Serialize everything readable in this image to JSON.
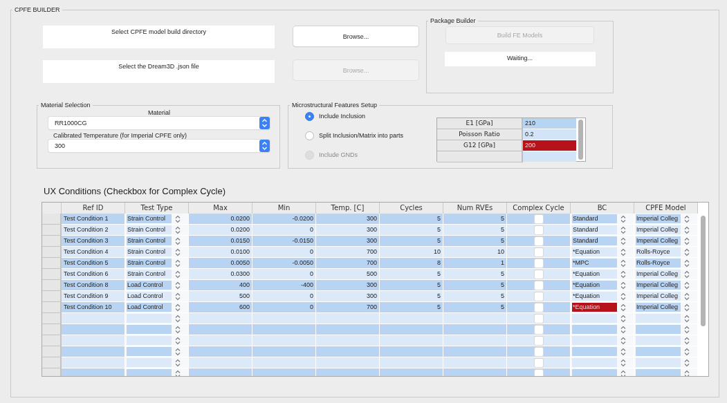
{
  "builder": {
    "title": "CPFE BUILDER",
    "directory": {
      "label": "Select CPFE model build directory",
      "browse": {
        "label": "Browse...",
        "disabled": false
      }
    },
    "json_file": {
      "label": "Select the Dream3D .json file",
      "browse": {
        "label": "Browse...",
        "disabled": true
      }
    },
    "package_builder": {
      "title": "Package Builder",
      "build_button": {
        "label": "Build FE Models",
        "disabled": true
      },
      "status": "Waiting..."
    },
    "material_selection": {
      "title": "Material Selection",
      "material_label": "Material",
      "material": "RR1000CG",
      "temperature_label": "Calibrated Temperature (for Imperial CPFE only)",
      "temperature": "300"
    },
    "microstructure": {
      "title": "Microstructural Features Setup",
      "options": [
        {
          "label": "Include Inclusion",
          "selected": true,
          "disabled": false
        },
        {
          "label": "Split Inclusion/Matrix into parts",
          "selected": false,
          "disabled": false
        },
        {
          "label": "Include GNDs",
          "selected": false,
          "disabled": true
        }
      ],
      "properties": [
        {
          "name": "E1 [GPa]",
          "value": "210",
          "invalid": false
        },
        {
          "name": "Poisson Ratio",
          "value": "0.2",
          "invalid": false
        },
        {
          "name": "G12 [GPa]",
          "value": "200",
          "invalid": true
        },
        {
          "invalid": false
        }
      ]
    },
    "ux_conditions": {
      "title": "UX Conditions (Checkbox for Complex Cycle)",
      "columns": [
        "Ref ID",
        "Test Type",
        "Max",
        "Min",
        "Temp. [C]",
        "Cycles",
        "Num RVEs",
        "Complex Cycle",
        "BC",
        "CPFE Model"
      ],
      "rows": [
        {
          "ref_id": "Test Condition 1",
          "test_type": "Strain Control",
          "max": "0.0200",
          "min": "-0.0200",
          "temp": "300",
          "cycles": "5",
          "num_rves": "5",
          "complex_cycle": false,
          "bc": "Standard",
          "bc_invalid": false,
          "cpfe_model": "Imperial Colleg"
        },
        {
          "ref_id": "Test Condition 2",
          "test_type": "Strain Control",
          "max": "0.0200",
          "min": "0",
          "temp": "300",
          "cycles": "5",
          "num_rves": "5",
          "complex_cycle": false,
          "bc": "Standard",
          "bc_invalid": false,
          "cpfe_model": "Imperial Colleg"
        },
        {
          "ref_id": "Test Condition 3",
          "test_type": "Strain Control",
          "max": "0.0150",
          "min": "-0.0150",
          "temp": "300",
          "cycles": "5",
          "num_rves": "5",
          "complex_cycle": false,
          "bc": "Standard",
          "bc_invalid": false,
          "cpfe_model": "Imperial Colleg"
        },
        {
          "ref_id": "Test Condition 4",
          "test_type": "Strain Control",
          "max": "0.0100",
          "min": "0",
          "temp": "700",
          "cycles": "10",
          "num_rves": "10",
          "complex_cycle": false,
          "bc": "*Equation",
          "bc_invalid": false,
          "cpfe_model": "Rolls-Royce"
        },
        {
          "ref_id": "Test Condition 5",
          "test_type": "Strain Control",
          "max": "0.0050",
          "min": "-0.0050",
          "temp": "700",
          "cycles": "8",
          "num_rves": "1",
          "complex_cycle": false,
          "bc": "*MPC",
          "bc_invalid": false,
          "cpfe_model": "Rolls-Royce"
        },
        {
          "ref_id": "Test Condition 6",
          "test_type": "Strain Control",
          "max": "0.0300",
          "min": "0",
          "temp": "500",
          "cycles": "5",
          "num_rves": "5",
          "complex_cycle": false,
          "bc": "*Equation",
          "bc_invalid": false,
          "cpfe_model": "Imperial Colleg"
        },
        {
          "ref_id": "Test Condition 8",
          "test_type": "Load Control",
          "max": "400",
          "min": "-400",
          "temp": "300",
          "cycles": "5",
          "num_rves": "5",
          "complex_cycle": false,
          "bc": "*Equation",
          "bc_invalid": false,
          "cpfe_model": "Imperial Colleg"
        },
        {
          "ref_id": "Test Condition 9",
          "test_type": "Load Control",
          "max": "500",
          "min": "0",
          "temp": "300",
          "cycles": "5",
          "num_rves": "5",
          "complex_cycle": false,
          "bc": "*Equation",
          "bc_invalid": false,
          "cpfe_model": "Imperial Colleg"
        },
        {
          "ref_id": "Test Condition 10",
          "test_type": "Load Control",
          "max": "600",
          "min": "0",
          "temp": "700",
          "cycles": "5",
          "num_rves": "5",
          "complex_cycle": false,
          "bc": "*Equation",
          "bc_invalid": true,
          "cpfe_model": "Imperial Colleg"
        },
        {
          "complex_cycle": false
        },
        {
          "complex_cycle": false
        },
        {
          "complex_cycle": false
        },
        {
          "complex_cycle": false
        },
        {
          "complex_cycle": false
        },
        {
          "complex_cycle": false
        }
      ]
    }
  }
}
